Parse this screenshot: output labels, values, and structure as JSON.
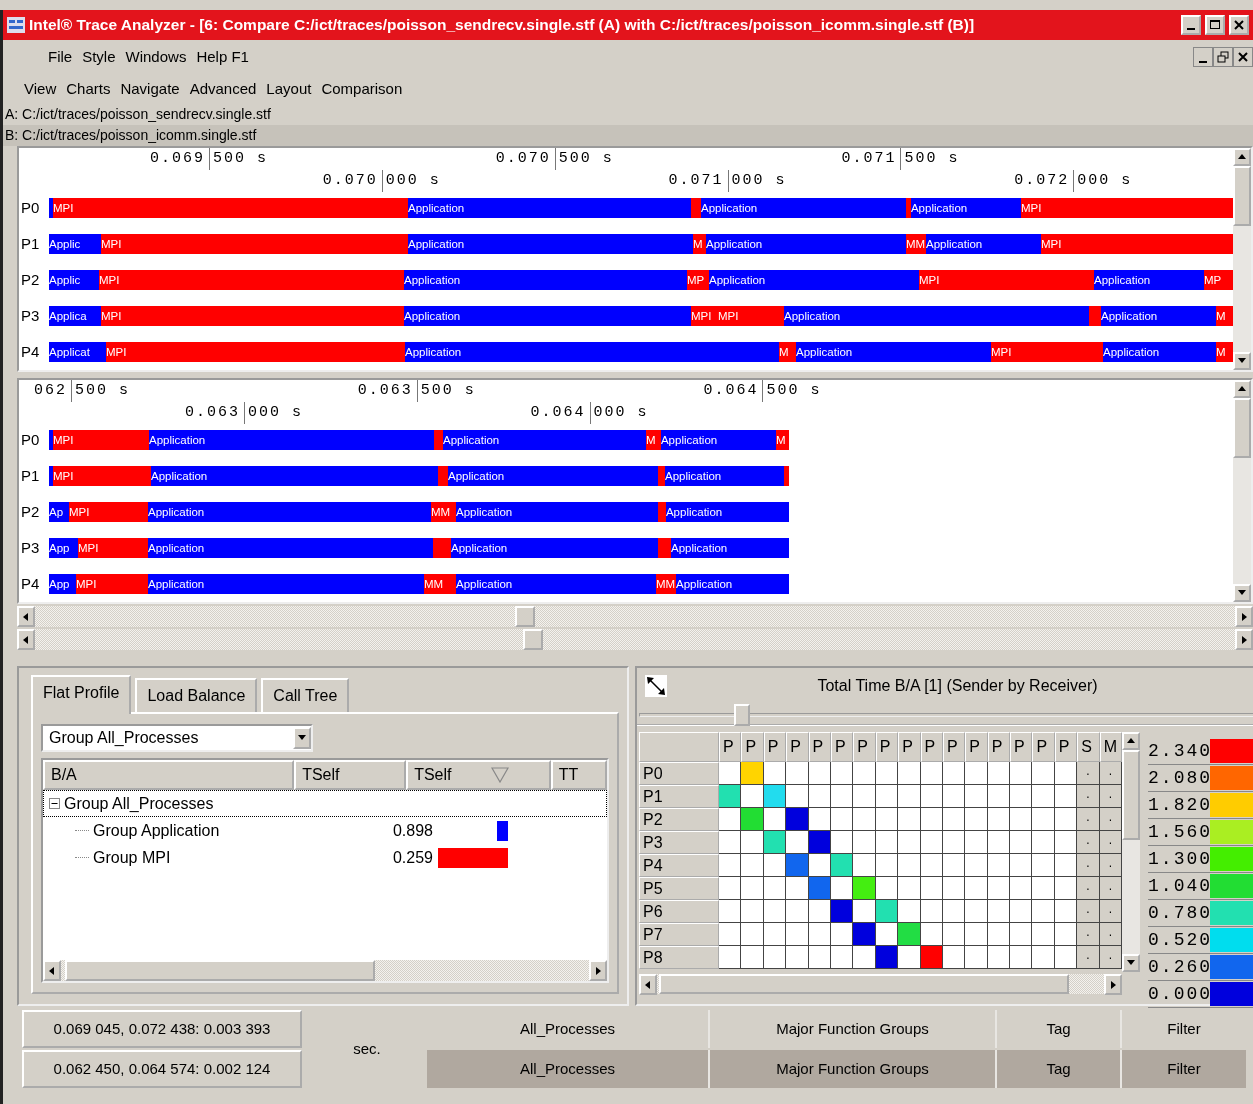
{
  "window": {
    "title": "Intel® Trace Analyzer - [6: Compare C:/ict/traces/poisson_sendrecv.single.stf (A) with C:/ict/traces/poisson_icomm.single.stf (B)]"
  },
  "menu": [
    "File",
    "Style",
    "Windows",
    "Help F1"
  ],
  "view_menu": [
    "View",
    "Charts",
    "Navigate",
    "Advanced",
    "Layout",
    "Comparison"
  ],
  "files": [
    {
      "text": "A: C:/ict/traces/poisson_sendrecv.single.stf",
      "selected": false
    },
    {
      "text": "B: C:/ict/traces/poisson_icomm.single.stf",
      "selected": true
    }
  ],
  "timelines": [
    {
      "ticks": [
        {
          "kind": "upper",
          "major": "0.069",
          "minor": "500 s"
        },
        {
          "kind": "lower",
          "major": "0.070",
          "minor": "000 s"
        },
        {
          "kind": "upper",
          "major": "0.070",
          "minor": "500 s"
        },
        {
          "kind": "lower",
          "major": "0.071",
          "minor": "000 s"
        },
        {
          "kind": "upper",
          "major": "0.071",
          "minor": "500 s"
        },
        {
          "kind": "lower",
          "major": "0.072",
          "minor": "000 s"
        }
      ],
      "rows": [
        {
          "label": "P0",
          "segments": [
            {
              "kind": "app"
            },
            {
              "kind": "mpi",
              "label": "MPI"
            },
            {
              "kind": "app",
              "label": "Application"
            },
            {
              "kind": "mpi"
            },
            {
              "kind": "app",
              "label": "Application"
            },
            {
              "kind": "mpi"
            },
            {
              "kind": "app",
              "label": "Application"
            },
            {
              "kind": "mpi",
              "label": "MPI"
            }
          ]
        },
        {
          "label": "P1",
          "segments": [
            {
              "kind": "app",
              "label": "Applic"
            },
            {
              "kind": "mpi",
              "label": "MPI"
            },
            {
              "kind": "app",
              "label": "Application"
            },
            {
              "kind": "mpi",
              "label": "M"
            },
            {
              "kind": "app",
              "label": "Application"
            },
            {
              "kind": "mpi",
              "label": "MM"
            },
            {
              "kind": "app",
              "label": "Application"
            },
            {
              "kind": "mpi",
              "label": "MPI"
            }
          ]
        },
        {
          "label": "P2",
          "segments": [
            {
              "kind": "app",
              "label": "Applic"
            },
            {
              "kind": "mpi",
              "label": "MPI"
            },
            {
              "kind": "app",
              "label": "Application"
            },
            {
              "kind": "mpi",
              "label": "MP"
            },
            {
              "kind": "app",
              "label": "Application"
            },
            {
              "kind": "mpi",
              "label": "MPI"
            },
            {
              "kind": "app",
              "label": "Application"
            },
            {
              "kind": "mpi",
              "label": "MP"
            }
          ]
        },
        {
          "label": "P3",
          "segments": [
            {
              "kind": "app",
              "label": "Applica"
            },
            {
              "kind": "mpi",
              "label": "MPI"
            },
            {
              "kind": "app",
              "label": "Application"
            },
            {
              "kind": "mpi",
              "label": "MPI"
            },
            {
              "kind": "mpi",
              "label": "MPI"
            },
            {
              "kind": "app",
              "label": "Application"
            },
            {
              "kind": "mpi"
            },
            {
              "kind": "app",
              "label": "Application"
            },
            {
              "kind": "mpi",
              "label": "M"
            }
          ]
        },
        {
          "label": "P4",
          "segments": [
            {
              "kind": "app",
              "label": "Applicat"
            },
            {
              "kind": "mpi",
              "label": "MPI"
            },
            {
              "kind": "app",
              "label": "Application"
            },
            {
              "kind": "mpi",
              "label": "M"
            },
            {
              "kind": "app",
              "label": "Application"
            },
            {
              "kind": "mpi",
              "label": "MPI"
            },
            {
              "kind": "app",
              "label": "Application"
            },
            {
              "kind": "mpi",
              "label": "M"
            }
          ]
        }
      ]
    },
    {
      "ticks": [
        {
          "kind": "upper",
          "major": "062",
          "minor": "500 s"
        },
        {
          "kind": "lower",
          "major": "0.063",
          "minor": "000 s"
        },
        {
          "kind": "upper",
          "major": "0.063",
          "minor": "500 s"
        },
        {
          "kind": "lower",
          "major": "0.064",
          "minor": "000 s"
        },
        {
          "kind": "upper",
          "major": "0.064",
          "minor": "500 s"
        }
      ],
      "rows": [
        {
          "label": "P0",
          "segments": [
            {
              "kind": "app"
            },
            {
              "kind": "mpi",
              "label": "MPI"
            },
            {
              "kind": "app",
              "label": "Application"
            },
            {
              "kind": "mpi"
            },
            {
              "kind": "app",
              "label": "Application"
            },
            {
              "kind": "mpi",
              "label": "M"
            },
            {
              "kind": "app",
              "label": "Application"
            },
            {
              "kind": "mpi",
              "label": "M"
            }
          ]
        },
        {
          "label": "P1",
          "segments": [
            {
              "kind": "app"
            },
            {
              "kind": "mpi",
              "label": "MPI"
            },
            {
              "kind": "app",
              "label": "Application"
            },
            {
              "kind": "mpi"
            },
            {
              "kind": "app",
              "label": "Application"
            },
            {
              "kind": "mpi"
            },
            {
              "kind": "app",
              "label": "Application"
            },
            {
              "kind": "mpi"
            }
          ]
        },
        {
          "label": "P2",
          "segments": [
            {
              "kind": "app",
              "label": "Ap"
            },
            {
              "kind": "mpi",
              "label": "MPI"
            },
            {
              "kind": "app",
              "label": "Application"
            },
            {
              "kind": "mpi",
              "label": "MM"
            },
            {
              "kind": "app",
              "label": "Application"
            },
            {
              "kind": "mpi"
            },
            {
              "kind": "app",
              "label": "Application"
            }
          ]
        },
        {
          "label": "P3",
          "segments": [
            {
              "kind": "app",
              "label": "App"
            },
            {
              "kind": "mpi",
              "label": "MPI"
            },
            {
              "kind": "app",
              "label": "Application"
            },
            {
              "kind": "mpi"
            },
            {
              "kind": "app",
              "label": "Application"
            },
            {
              "kind": "mpi"
            },
            {
              "kind": "app",
              "label": "Application"
            }
          ]
        },
        {
          "label": "P4",
          "segments": [
            {
              "kind": "app",
              "label": "App"
            },
            {
              "kind": "mpi",
              "label": "MPI"
            },
            {
              "kind": "app",
              "label": "Application"
            },
            {
              "kind": "mpi",
              "label": "MM"
            },
            {
              "kind": "app",
              "label": "Application"
            },
            {
              "kind": "mpi",
              "label": "MM"
            },
            {
              "kind": "app",
              "label": "Application"
            }
          ]
        }
      ]
    }
  ],
  "flat_profile": {
    "tabs": [
      {
        "label": "Flat Profile",
        "selected": true
      },
      {
        "label": "Load Balance",
        "selected": false
      },
      {
        "label": "Call Tree",
        "selected": false
      }
    ],
    "group_select": {
      "value": "Group All_Processes"
    },
    "columns": [
      {
        "label": "B/A",
        "sorted": false
      },
      {
        "label": "TSelf",
        "sorted": false
      },
      {
        "label": "TSelf",
        "sorted": true
      },
      {
        "label": "TT",
        "sorted": false
      }
    ],
    "tree": [
      {
        "label": "Group All_Processes",
        "expanded": true,
        "focused": true,
        "children": [
          {
            "label": "Group Application",
            "value": "0.898",
            "color": "#0000ff",
            "focused": false
          },
          {
            "label": "Group MPI",
            "value": "0.259",
            "color": "#ff0000",
            "focused": false
          }
        ]
      }
    ]
  },
  "matrix": {
    "title": "Total Time B/A [1] (Sender by Receiver)",
    "zoom_slider": {
      "level": 0.16
    },
    "columns": [
      "P",
      "P",
      "P",
      "P",
      "P",
      "P",
      "P",
      "P",
      "P",
      "P",
      "P",
      "P",
      "P",
      "P",
      "P",
      "P",
      "S",
      "M"
    ],
    "rows": [
      {
        "label": "P0",
        "cells": [
          null,
          {
            "color": "#ffd400"
          },
          null,
          null,
          null,
          null,
          null,
          null,
          null,
          null,
          null,
          null,
          null,
          null,
          null,
          null,
          {
            "text": "."
          },
          {
            "text": "."
          }
        ]
      },
      {
        "label": "P1",
        "cells": [
          {
            "color": "#22e0b0"
          },
          null,
          {
            "color": "#22dcee"
          },
          null,
          null,
          null,
          null,
          null,
          null,
          null,
          null,
          null,
          null,
          null,
          null,
          null,
          {
            "text": "."
          },
          {
            "text": "."
          }
        ]
      },
      {
        "label": "P2",
        "cells": [
          null,
          {
            "color": "#22dd33"
          },
          null,
          {
            "color": "#0000dd"
          },
          null,
          null,
          null,
          null,
          null,
          null,
          null,
          null,
          null,
          null,
          null,
          null,
          {
            "text": "."
          },
          {
            "text": "."
          }
        ]
      },
      {
        "label": "P3",
        "cells": [
          null,
          null,
          {
            "color": "#22e0b0"
          },
          null,
          {
            "color": "#0000dd"
          },
          null,
          null,
          null,
          null,
          null,
          null,
          null,
          null,
          null,
          null,
          null,
          {
            "text": "."
          },
          {
            "text": "."
          }
        ]
      },
      {
        "label": "P4",
        "cells": [
          null,
          null,
          null,
          {
            "color": "#1166ee"
          },
          null,
          {
            "color": "#22e0b0"
          },
          null,
          null,
          null,
          null,
          null,
          null,
          null,
          null,
          null,
          null,
          {
            "text": "."
          },
          {
            "text": "."
          }
        ]
      },
      {
        "label": "P5",
        "cells": [
          null,
          null,
          null,
          null,
          {
            "color": "#1166ee"
          },
          null,
          {
            "color": "#44ee11"
          },
          null,
          null,
          null,
          null,
          null,
          null,
          null,
          null,
          null,
          {
            "text": "."
          },
          {
            "text": "."
          }
        ]
      },
      {
        "label": "P6",
        "cells": [
          null,
          null,
          null,
          null,
          null,
          {
            "color": "#0000dd"
          },
          null,
          {
            "color": "#22e0b0"
          },
          null,
          null,
          null,
          null,
          null,
          null,
          null,
          null,
          {
            "text": "."
          },
          {
            "text": "."
          }
        ]
      },
      {
        "label": "P7",
        "cells": [
          null,
          null,
          null,
          null,
          null,
          null,
          {
            "color": "#0000dd"
          },
          null,
          {
            "color": "#22dd44"
          },
          null,
          null,
          null,
          null,
          null,
          null,
          null,
          {
            "text": "."
          },
          {
            "text": "."
          }
        ]
      },
      {
        "label": "P8",
        "cells": [
          null,
          null,
          null,
          null,
          null,
          null,
          null,
          {
            "color": "#0000dd"
          },
          null,
          {
            "color": "#ff0000"
          },
          null,
          null,
          null,
          null,
          null,
          null,
          {
            "text": "."
          },
          {
            "text": "."
          }
        ]
      }
    ],
    "legend": [
      {
        "value": "2.340",
        "color": "#ff0000"
      },
      {
        "value": "2.080",
        "color": "#ff6600"
      },
      {
        "value": "1.820",
        "color": "#ffcc00"
      },
      {
        "value": "1.560",
        "color": "#aaee22"
      },
      {
        "value": "1.300",
        "color": "#44ee00"
      },
      {
        "value": "1.040",
        "color": "#22dd33"
      },
      {
        "value": "0.780",
        "color": "#22e0b0"
      },
      {
        "value": "0.520",
        "color": "#00ddee"
      },
      {
        "value": "0.260",
        "color": "#1166ee"
      },
      {
        "value": "0.000",
        "color": "#0000dd"
      }
    ]
  },
  "status_bar": {
    "unit": "sec.",
    "rows": [
      {
        "range": "0.069 045, 0.072 438: 0.003 393",
        "selected": false,
        "cells": [
          "All_Processes",
          "Major Function Groups",
          "Tag",
          "Filter"
        ]
      },
      {
        "range": "0.062 450, 0.064 574: 0.002 124",
        "selected": true,
        "cells": [
          "All_Processes",
          "Major Function Groups",
          "Tag",
          "Filter"
        ]
      }
    ]
  }
}
